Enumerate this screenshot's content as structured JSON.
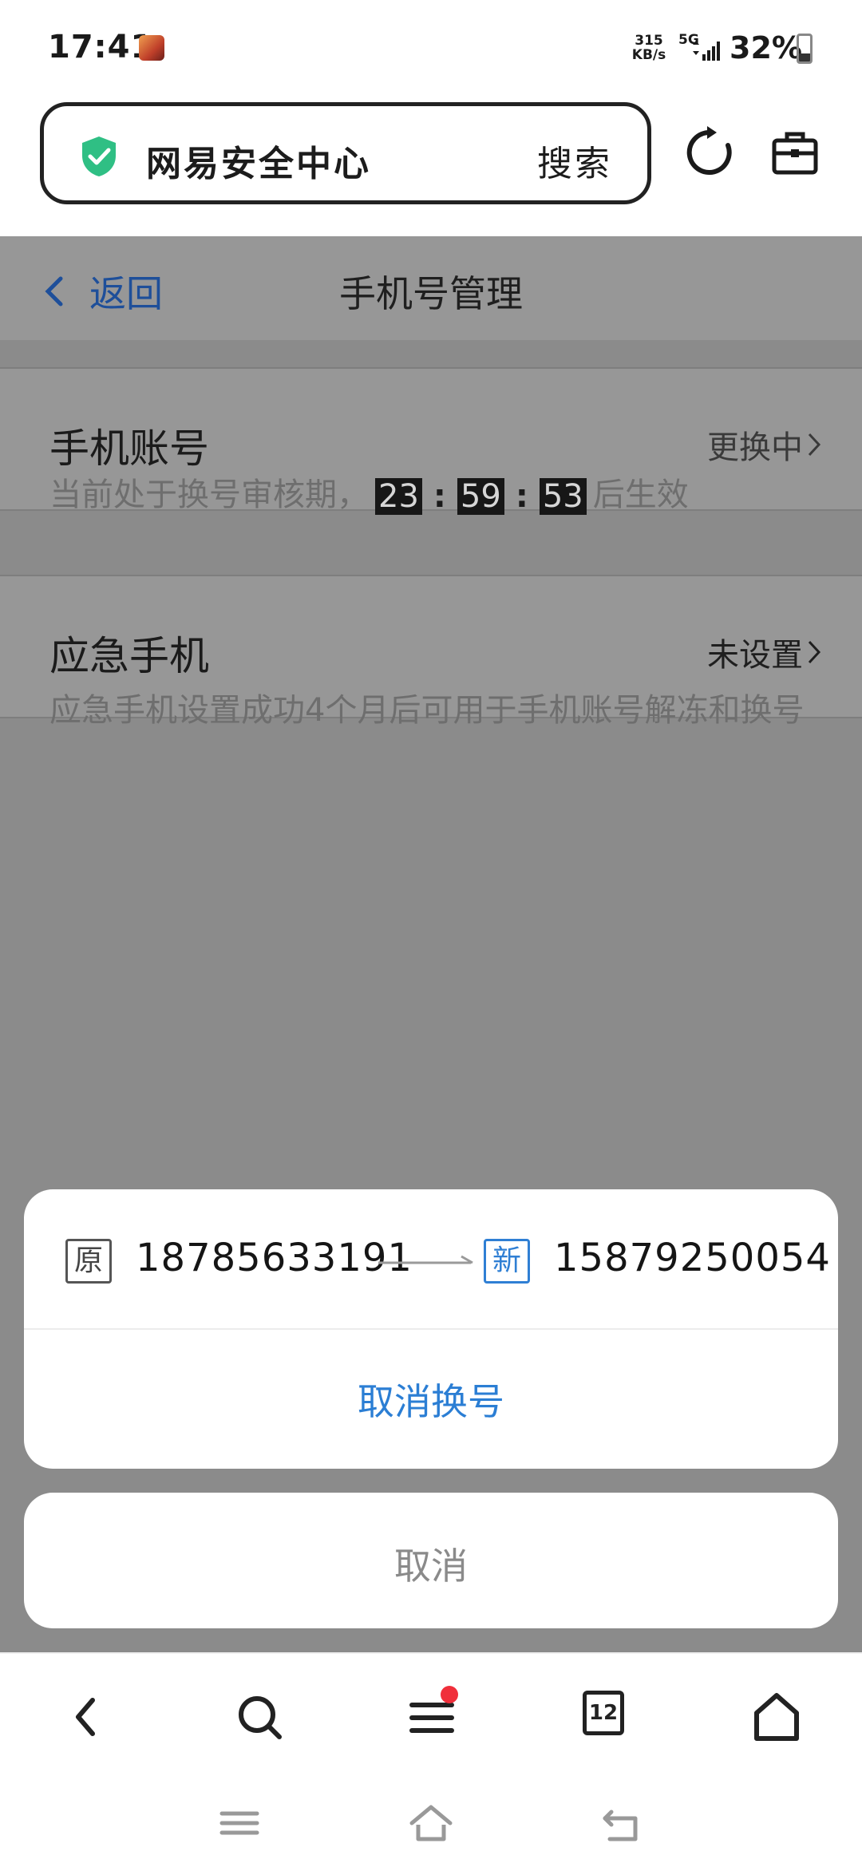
{
  "status_bar": {
    "time": "17:41",
    "speed_value": "315",
    "speed_unit": "KB/s",
    "network": "5G",
    "battery": "32%"
  },
  "browser": {
    "address_text": "网易安全中心",
    "search_label": "搜索",
    "icons": [
      "shield-check-icon",
      "refresh-icon",
      "toolbox-icon"
    ]
  },
  "page": {
    "back_label": "返回",
    "title": "手机号管理",
    "phone_account": {
      "label": "手机账号",
      "value": "更换中"
    },
    "review_note": {
      "prefix": "当前处于换号审核期，",
      "hours": "23",
      "minutes": "59",
      "seconds": "53",
      "separator": ":",
      "suffix": "后生效"
    },
    "emergency_phone": {
      "label": "应急手机",
      "value": "未设置"
    },
    "emergency_note": "应急手机设置成功4个月后可用于手机账号解冻和换号"
  },
  "action_sheet": {
    "old_tag": "原",
    "old_number": "18785633191",
    "new_tag": "新",
    "new_number": "15879250054",
    "cancel_change_label": "取消换号",
    "cancel_label": "取消"
  },
  "bottom_toolbar": {
    "tabs_count": "12",
    "icons": [
      "back-icon",
      "search-icon",
      "menu-icon",
      "tabs-icon",
      "home-icon"
    ]
  },
  "colors": {
    "link_blue": "#2b7ed4",
    "overlay_gray": "#8b8b8b",
    "notification_red": "#f02f3b",
    "shield_green": "#2fbf84"
  }
}
